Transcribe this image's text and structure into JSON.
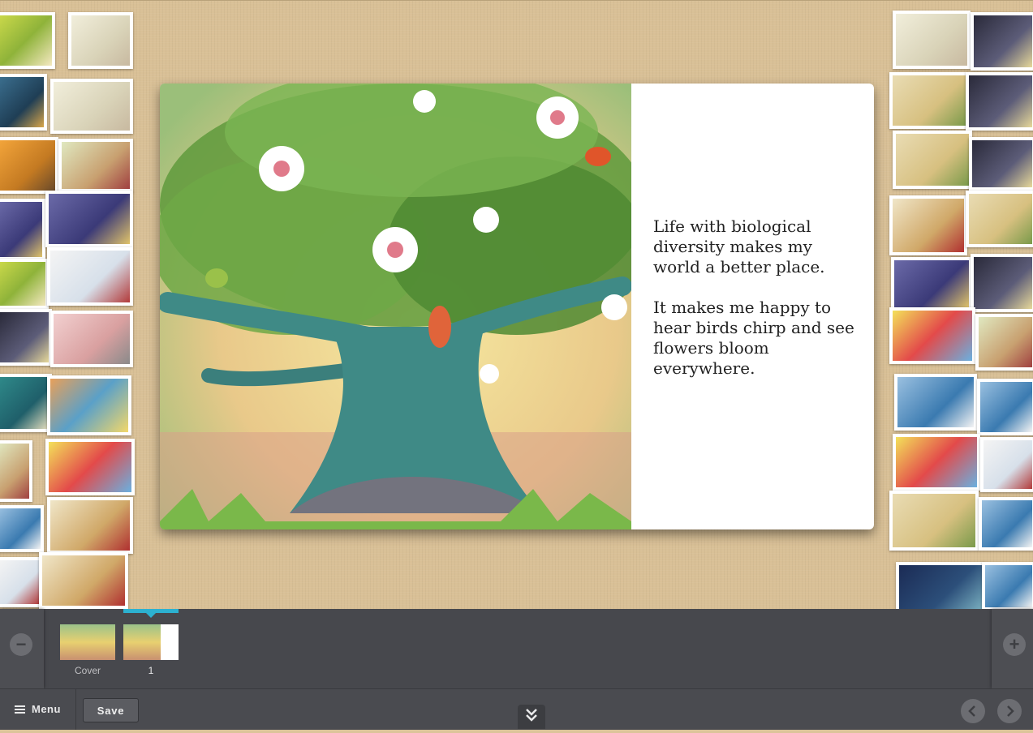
{
  "story": {
    "paragraphs": [
      "Life with biological diversity makes my world a better place.",
      "It makes me happy to hear birds chirp and see flowers bloom everywhere."
    ]
  },
  "filmstrip": {
    "zoom_out_symbol": "−",
    "zoom_in_symbol": "+",
    "pages": [
      {
        "label": "Cover"
      },
      {
        "label": "1"
      }
    ]
  },
  "toolbar": {
    "menu_label": "Menu",
    "save_label": "Save"
  },
  "icons": {
    "menu": "hamburger-icon",
    "collapse": "double-chevron-down-icon",
    "prev": "chevron-left-icon",
    "next": "chevron-right-icon",
    "zoom_out": "minus-icon",
    "zoom_in": "plus-icon"
  },
  "colors": {
    "canvas": "#d9c096",
    "filmstrip": "#47484d",
    "toolbar": "#4a4b50",
    "active_page_indicator": "#2cb1d0"
  }
}
